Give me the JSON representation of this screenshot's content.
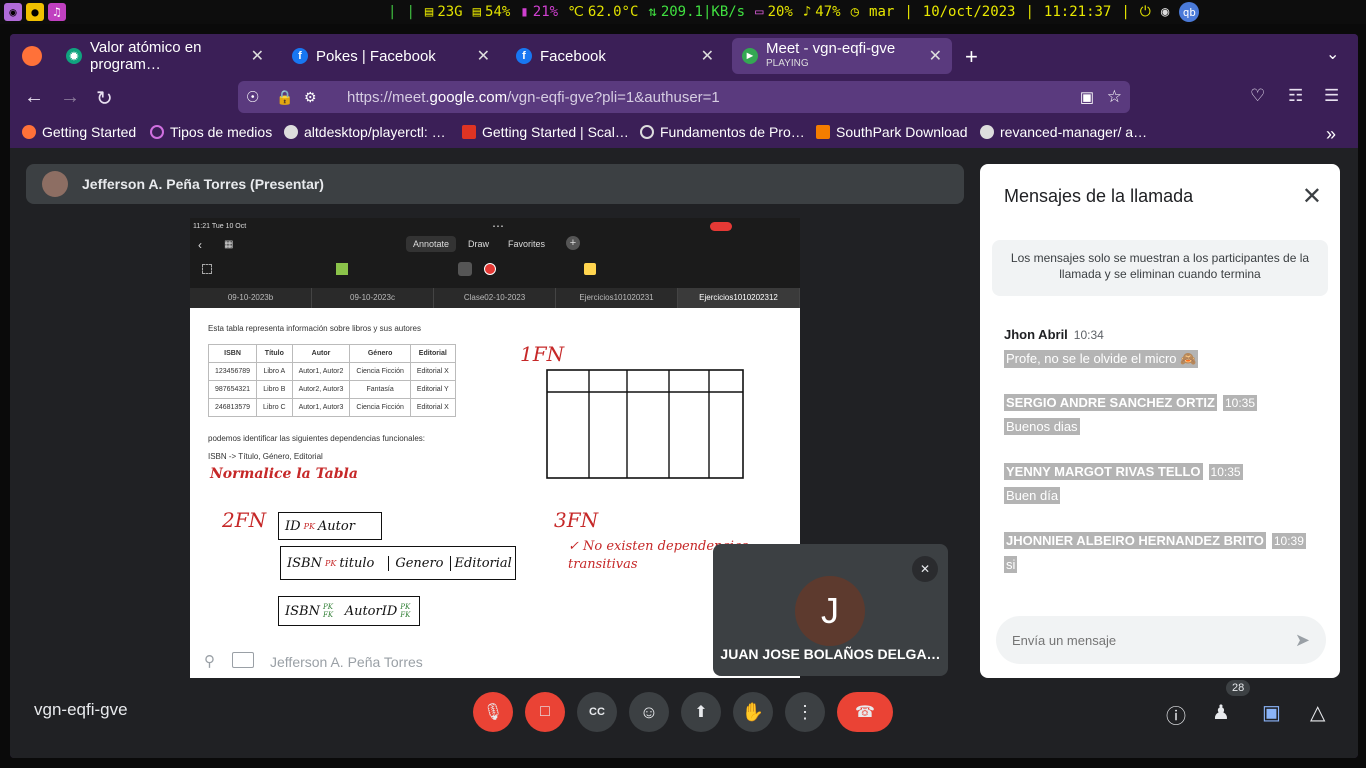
{
  "system_bar": {
    "segments": [
      "23G",
      "54%",
      "21%",
      "62.0°C",
      "209.1|KB/s",
      "20%",
      "47%",
      "mar",
      "10/oct/2023",
      "11:21:37"
    ]
  },
  "browser": {
    "tabs": [
      {
        "title": "Valor atómico en program…",
        "sub": ""
      },
      {
        "title": "Pokes | Facebook",
        "sub": ""
      },
      {
        "title": "Facebook",
        "sub": ""
      },
      {
        "title": "Meet - vgn-eqfi-gve",
        "sub": "PLAYING"
      }
    ],
    "url_prefix": "https://meet.",
    "url_host": "google.com",
    "url_path": "/vgn-eqfi-gve?pli=1&authuser=1",
    "bookmarks": [
      "Getting Started",
      "Tipos de medios",
      "altdesktop/playerctl: …",
      "Getting Started | Scal…",
      "Fundamentos de Pro…",
      "SouthPark Download",
      "revanced-manager/ a…"
    ]
  },
  "meet": {
    "presenter_label": "Jefferson A. Peña Torres (Presentar)",
    "share": {
      "status_time": "11:21  Tue 10 Oct",
      "toolbar_tabs": [
        "Annotate",
        "Draw",
        "Favorites"
      ],
      "doc_tabs": [
        "09-10-2023b",
        "09-10-2023c",
        "Clase02-10-2023",
        "Ejercicios101020231",
        "Ejercicios1010202312"
      ],
      "intro": "Esta tabla representa información sobre libros y sus autores",
      "table": {
        "headers": [
          "ISBN",
          "Título",
          "Autor",
          "Género",
          "Editorial"
        ],
        "rows": [
          [
            "123456789",
            "Libro A",
            "Autor1, Autor2",
            "Ciencia Ficción",
            "Editorial X"
          ],
          [
            "987654321",
            "Libro B",
            "Autor2, Autor3",
            "Fantasía",
            "Editorial Y"
          ],
          [
            "246813579",
            "Libro C",
            "Autor1, Autor3",
            "Ciencia Ficción",
            "Editorial X"
          ]
        ]
      },
      "deps_line": "podemos identificar las siguientes dependencias funcionales:",
      "dep": "ISBN -> Título, Género, Editorial",
      "hand_normalize": "Normalice la Tabla",
      "hand_1fn": "1FN",
      "hand_2fn": "2FN",
      "hand_3fn": "3FN",
      "hand_3fn_note": "No existen dependencias transitivas",
      "hand_box1": [
        "ID",
        "PK",
        "Autor"
      ],
      "hand_box2": [
        "ISBN",
        "PK",
        "titulo",
        "Genero",
        "Editorial"
      ],
      "hand_box3": [
        "ISBN",
        "PK FK",
        "AutorID",
        "PK FK"
      ],
      "caption": "Jefferson A. Peña Torres"
    },
    "participant_tile": {
      "initial": "J",
      "name": "JUAN JOSE BOLAÑOS DELGA…"
    },
    "chat": {
      "title": "Mensajes de la llamada",
      "notice": "Los mensajes solo se muestran a los participantes de la llamada y se eliminan cuando termina",
      "messages": [
        {
          "author": "Jhon Abril",
          "time": "10:34",
          "text": "Profe, no se le olvide el micro 🙈"
        },
        {
          "author": "SERGIO ANDRE SANCHEZ ORTIZ",
          "time": "10:35",
          "text": "Buenos dias"
        },
        {
          "author": "YENNY MARGOT RIVAS TELLO",
          "time": "10:35",
          "text": "Buen día"
        },
        {
          "author": "JHONNIER ALBEIRO HERNANDEZ BRITO",
          "time": "10:39",
          "text": "si"
        }
      ],
      "placeholder": "Envía un mensaje"
    },
    "meeting_code": "vgn-eqfi-gve",
    "participant_count": "28"
  }
}
